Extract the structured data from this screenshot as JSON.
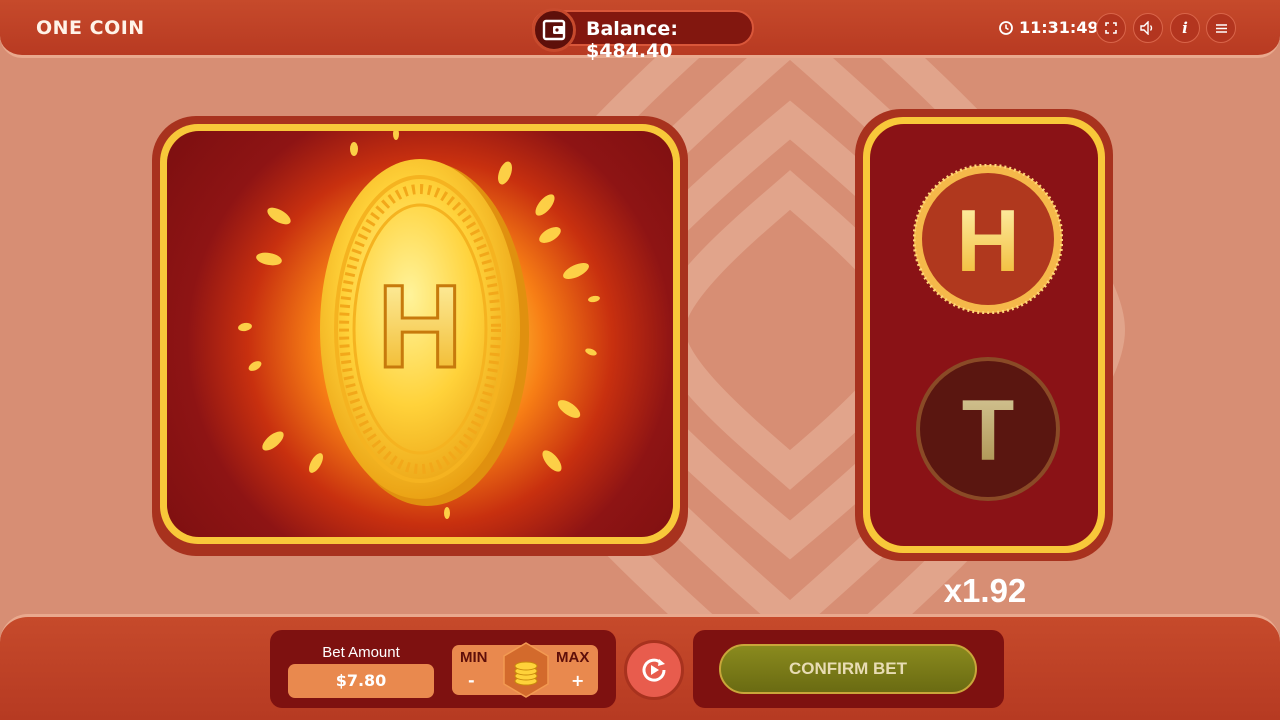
{
  "header": {
    "title": "ONE COIN",
    "balance": "Balance: $484.40",
    "time": "11:31:49"
  },
  "coin": {
    "face_letter": "H"
  },
  "choices": {
    "heads_label": "H",
    "tails_label": "T"
  },
  "multiplier": "x1.92",
  "bet": {
    "label": "Bet Amount",
    "value": "$7.80",
    "min_label": "MIN",
    "max_label": "MAX",
    "decrease_label": "-",
    "increase_label": "+"
  },
  "confirm_label": "CONFIRM BET",
  "colors": {
    "header": "#c64a2b",
    "background": "#d78e74",
    "card_gold": "#f8c83a",
    "card_dark": "#8a1216",
    "confirm_green": "#7a7b18"
  }
}
